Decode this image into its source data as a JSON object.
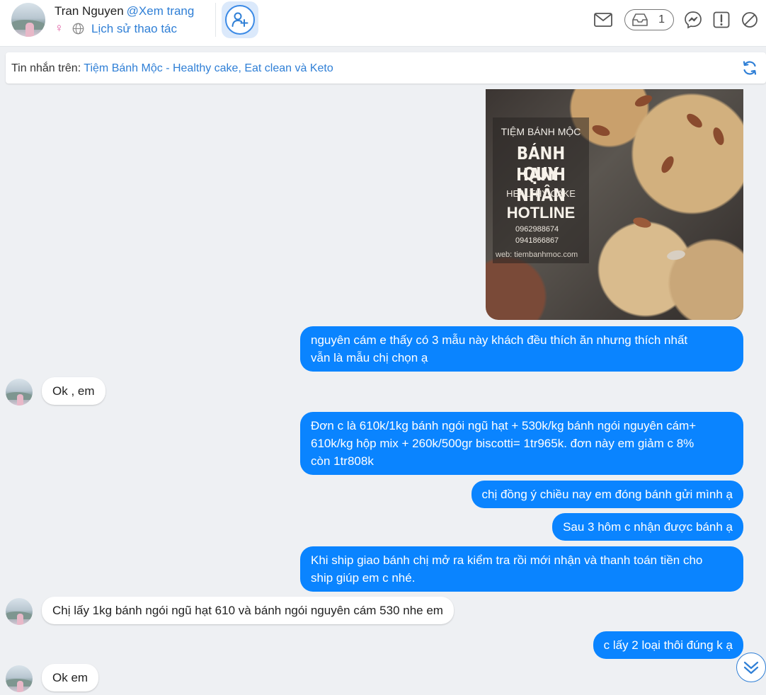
{
  "header": {
    "user_name": "Tran Nguyen",
    "view_page": "@Xem trang",
    "gender_symbol": "♀",
    "history_link": "Lịch sử thao tác",
    "inbox_count": "1"
  },
  "banner": {
    "label": "Tin nhắn trên: ",
    "page_name": "Tiệm Bánh Mộc - Healthy cake, Eat clean và Keto"
  },
  "image_post": {
    "shop": "TIỆM BÁNH MỘC",
    "title_line1": "BÁNH QUY",
    "title_line2": "HẠNH NHÂN",
    "subtitle": "HEALTHY CAKE",
    "hotline_label": "HOTLINE",
    "phone1": "0962988674",
    "phone2": "0941866867",
    "web": "web: tiembanhmoc.com"
  },
  "messages": [
    {
      "side": "out",
      "line1": "nguyên cám e thấy có 3 mẫu này khách đều thích ăn nhưng thích nhất",
      "line2": "vẫn là mẫu chị chọn ạ"
    },
    {
      "side": "in",
      "text": "Ok , em"
    },
    {
      "side": "out",
      "line1": "Đơn c là 610k/1kg bánh ngói ngũ hạt + 530k/kg bánh ngói nguyên cám+",
      "line2": "610k/kg hộp mix + 260k/500gr biscotti= 1tr965k. đơn này em giảm c 8%",
      "line3": "còn 1tr808k"
    },
    {
      "side": "out",
      "text": "chị đồng ý chiều nay em đóng bánh gửi mình ạ"
    },
    {
      "side": "out",
      "text": "Sau 3 hôm c nhận được bánh ạ"
    },
    {
      "side": "out",
      "line1": "Khi ship giao bánh chị mở ra kiểm tra rồi mới nhận và thanh toán tiền cho",
      "line2": "ship giúp em c nhé."
    },
    {
      "side": "in",
      "text": "Chị lấy 1kg bánh ngói ngũ hạt 610 và bánh ngói nguyên cám 530 nhe em"
    },
    {
      "side": "out",
      "text": "c lấy 2 loại thôi đúng k ạ"
    },
    {
      "side": "in",
      "text": "Ok em"
    }
  ],
  "colors": {
    "accent": "#2f7fd6",
    "outgoing_bubble": "#0a84ff",
    "background": "#eef0f3"
  },
  "icons": [
    "mail-icon",
    "inbox-icon",
    "messenger-icon",
    "report-icon",
    "block-icon",
    "refresh-icon",
    "add-friend-icon",
    "globe-icon",
    "scroll-down-icon"
  ]
}
